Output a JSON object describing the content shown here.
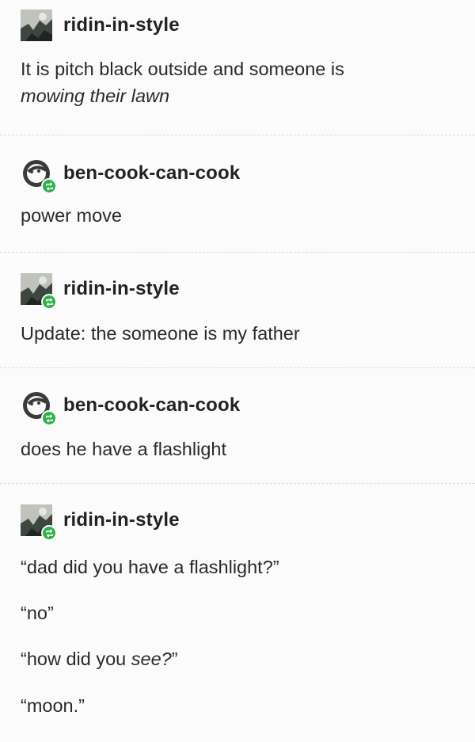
{
  "posts": [
    {
      "username": "ridin-in-style",
      "lines": [
        "It is pitch black outside and someone is"
      ],
      "italic_line": "mowing their lawn",
      "reblog": false
    },
    {
      "username": "ben-cook-can-cook",
      "lines": [
        "power move"
      ],
      "reblog": true
    },
    {
      "username": "ridin-in-style",
      "lines": [
        "Update: the someone is my father"
      ],
      "reblog": true
    },
    {
      "username": "ben-cook-can-cook",
      "lines": [
        "does he have a flashlight"
      ],
      "reblog": true
    },
    {
      "username": "ridin-in-style",
      "reblog": true,
      "quote1": "“dad did you have a flashlight?”",
      "quote2": "“no”",
      "quote3_prefix": "“how did you ",
      "quote3_italic": "see?",
      "quote3_suffix": "”",
      "quote4": "“moon.”"
    }
  ],
  "colors": {
    "badge": "#2bb34a",
    "separator": "#d9d9d9"
  },
  "icons": {
    "reblog": "reblog-icon"
  }
}
